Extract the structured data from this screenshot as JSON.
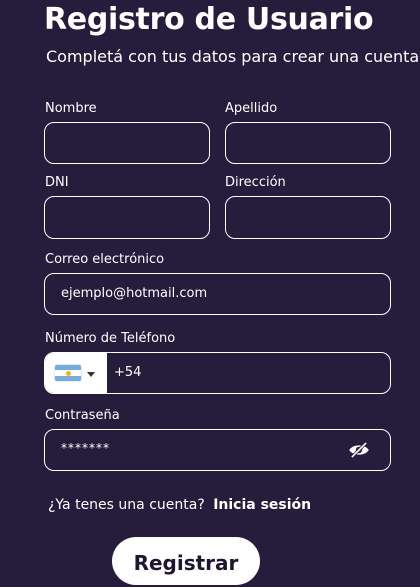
{
  "header": {
    "title": "Registro de Usuario",
    "subtitle": "Completá con tus datos para crear una cuenta"
  },
  "form": {
    "nombre": {
      "label": "Nombre",
      "value": ""
    },
    "apellido": {
      "label": "Apellido",
      "value": ""
    },
    "dni": {
      "label": "DNI",
      "value": ""
    },
    "direccion": {
      "label": "Dirección",
      "value": ""
    },
    "email": {
      "label": "Correo electrónico",
      "value": "ejemplo@hotmail.com"
    },
    "phone": {
      "label": "Número de Teléfono",
      "prefix": "+54",
      "country_icon": "argentina-flag-icon"
    },
    "password": {
      "label": "Contraseña",
      "value": "*******",
      "toggle_icon": "eye-slash-icon"
    }
  },
  "footer": {
    "question": "¿Ya tenes una cuenta?",
    "login_link": "Inicia sesión"
  },
  "submit_label": "Registrar",
  "colors": {
    "background": "#261c3b",
    "text": "#ffffff",
    "button_bg": "#ffffff",
    "flag_blue": "#74acdf",
    "flag_sun": "#f6b40e"
  }
}
